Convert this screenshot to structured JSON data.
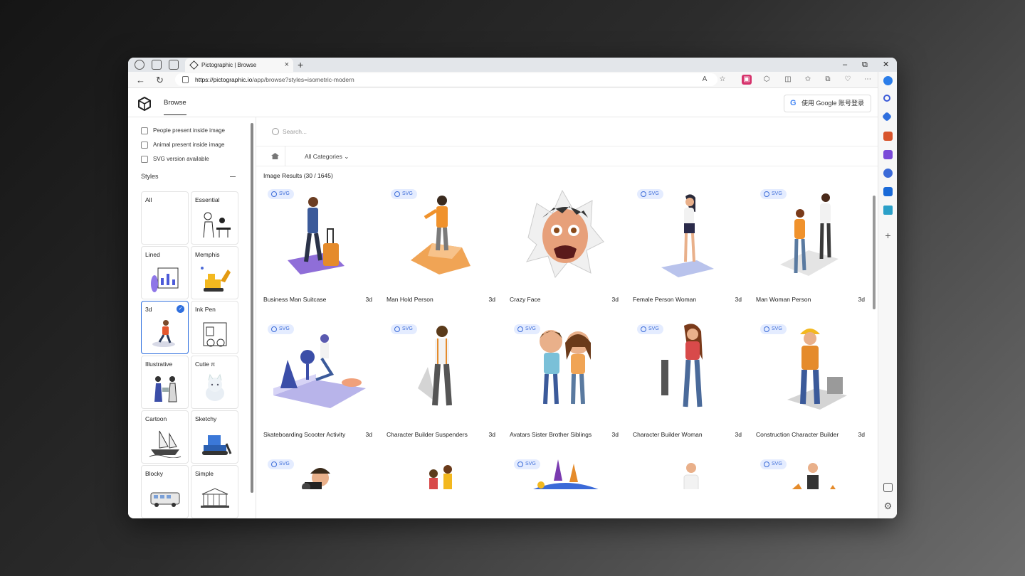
{
  "browser": {
    "tab_title": "Pictographic | Browse",
    "url_host": "https://pictographic.io",
    "url_path": "/app/browse?styles=isometric-modern",
    "new_tab": "+",
    "close_tab": "×",
    "minimize": "–",
    "restore": "⧉",
    "close": "✕"
  },
  "header": {
    "nav_browse": "Browse",
    "google_icon": "G",
    "google_login": "使用 Google 账号登录"
  },
  "filters": [
    {
      "label": "People present inside image",
      "checked": false
    },
    {
      "label": "Animal present inside image",
      "checked": false
    },
    {
      "label": "SVG version available",
      "checked": false
    }
  ],
  "styles_heading": "Styles",
  "styles": [
    {
      "label": "All",
      "icon": "blank"
    },
    {
      "label": "Essential",
      "icon": "essential-sketch-icon"
    },
    {
      "label": "Lined",
      "icon": "lined-illustration-icon"
    },
    {
      "label": "Memphis",
      "icon": "memphis-excavator-icon"
    },
    {
      "label": "3d",
      "icon": "3d-runner-icon",
      "selected": true,
      "check": "✓"
    },
    {
      "label": "Ink Pen",
      "icon": "inkpen-shop-icon"
    },
    {
      "label": "Illustrative",
      "icon": "illustrative-people-icon"
    },
    {
      "label": "Cutie π",
      "icon": "cutie-cat-icon"
    },
    {
      "label": "Cartoon",
      "icon": "cartoon-ship-icon"
    },
    {
      "label": "Sketchy",
      "icon": "sketchy-bulldozer-icon"
    },
    {
      "label": "Blocky",
      "icon": "blocky-bus-icon"
    },
    {
      "label": "Simple",
      "icon": "simple-building-icon"
    }
  ],
  "search": {
    "placeholder": "Search..."
  },
  "breadcrumb": {
    "category": "All Categories",
    "chevron": "⌄"
  },
  "results_label": "Image Results (30 / 1645)",
  "badge_text": "SVG",
  "results": [
    {
      "name": "Business Man Suitcase",
      "tag": "3d",
      "svg": true,
      "icon": "businessman-suitcase-image"
    },
    {
      "name": "Man Hold Person",
      "tag": "3d",
      "svg": true,
      "icon": "man-on-rock-image"
    },
    {
      "name": "Crazy Face",
      "tag": "3d",
      "svg": false,
      "icon": "crazy-face-image"
    },
    {
      "name": "Female Person Woman",
      "tag": "3d",
      "svg": true,
      "icon": "woman-standing-image"
    },
    {
      "name": "Man Woman Person",
      "tag": "3d",
      "svg": true,
      "icon": "couple-standing-image"
    },
    {
      "name": "Skateboarding Scooter Activity",
      "tag": "3d",
      "svg": true,
      "icon": "scooter-image"
    },
    {
      "name": "Character Builder Suspenders",
      "tag": "3d",
      "svg": true,
      "icon": "man-suspenders-image"
    },
    {
      "name": "Avatars Sister Brother Siblings",
      "tag": "3d",
      "svg": true,
      "icon": "siblings-image"
    },
    {
      "name": "Character Builder Woman",
      "tag": "3d",
      "svg": true,
      "icon": "woman-builder-image"
    },
    {
      "name": "Construction Character Builder",
      "tag": "3d",
      "svg": true,
      "icon": "construction-worker-image"
    },
    {
      "name": "",
      "tag": "",
      "svg": true,
      "icon": "photographer-image"
    },
    {
      "name": "",
      "tag": "",
      "svg": false,
      "icon": "family-image"
    },
    {
      "name": "",
      "tag": "",
      "svg": true,
      "icon": "fantasy-castle-image"
    },
    {
      "name": "",
      "tag": "",
      "svg": false,
      "icon": "man-white-shirt-image"
    },
    {
      "name": "",
      "tag": "",
      "svg": true,
      "icon": "man-jumping-image"
    }
  ],
  "colors": {
    "accent": "#2f6fde",
    "badge_bg": "#e4ecff",
    "badge_fg": "#3c6cd8"
  }
}
